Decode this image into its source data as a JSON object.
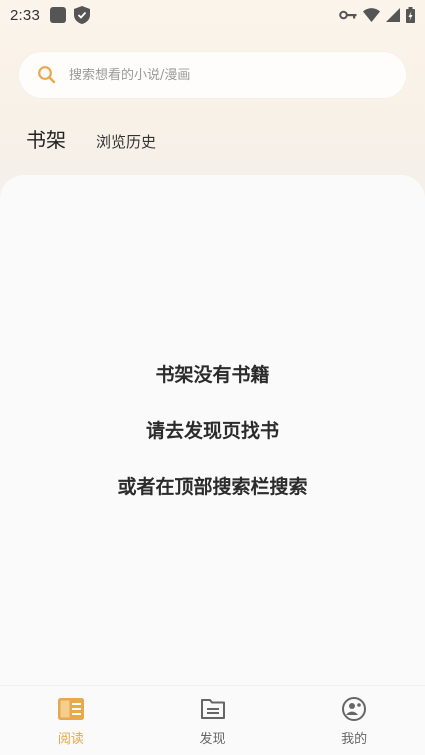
{
  "status_bar": {
    "time": "2:33"
  },
  "search": {
    "placeholder": "搜索想看的小说/漫画"
  },
  "tabs": [
    {
      "label": "书架",
      "active": true
    },
    {
      "label": "浏览历史",
      "active": false
    }
  ],
  "empty_state": {
    "line1": "书架没有书籍",
    "line2": "请去发现页找书",
    "line3": "或者在顶部搜索栏搜索"
  },
  "bottom_nav": [
    {
      "label": "阅读",
      "icon": "book-icon",
      "active": true
    },
    {
      "label": "发现",
      "icon": "folder-icon",
      "active": false
    },
    {
      "label": "我的",
      "icon": "profile-icon",
      "active": false
    }
  ],
  "colors": {
    "accent": "#e8a84c",
    "inactive": "#666666"
  }
}
